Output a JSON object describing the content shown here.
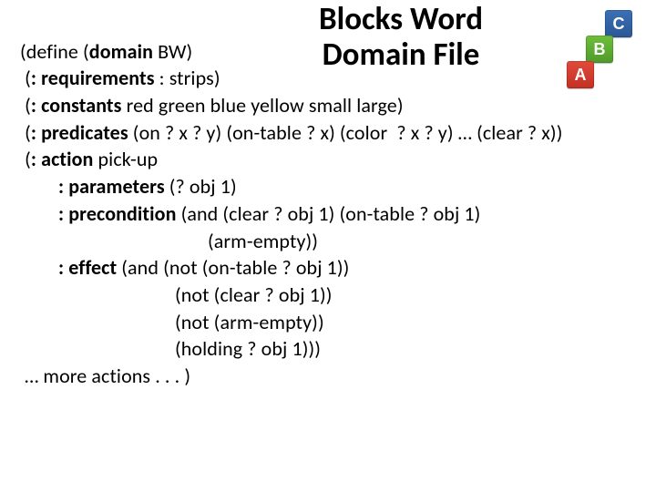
{
  "title": {
    "line1": "Blocks Word",
    "line2": "Domain File"
  },
  "blocks": {
    "c": "C",
    "b": "B",
    "a": "A"
  },
  "code": {
    "l1a": "(define (",
    "l1b": "domain",
    "l1c": " BW)",
    "l2a": " (",
    "l2b": ": requirements",
    "l2c": " : strips)",
    "l3a": " (",
    "l3b": ": constants",
    "l3c": " red green blue yellow small large)",
    "l4a": " (",
    "l4b": ": predicates",
    "l4c": " (on ? x ? y) (on-table ? x) (color  ? x ? y) … (clear ? x))",
    "l5a": " (",
    "l5b": ": action",
    "l5c": " pick-up",
    "l6a": ": parameters",
    "l6b": " (? obj 1)",
    "l7a": ": precondition",
    "l7b": " (and (clear ? obj 1) (on-table ? obj 1)",
    "l8": "(arm-empty))",
    "l9a": ": effect",
    "l9b": " (and (not (on-table ? obj 1))",
    "l10": "(not (clear ? obj 1))",
    "l11": "(not (arm-empty))",
    "l12": "(holding ? obj 1)))",
    "l13": " … more actions . . . )"
  }
}
